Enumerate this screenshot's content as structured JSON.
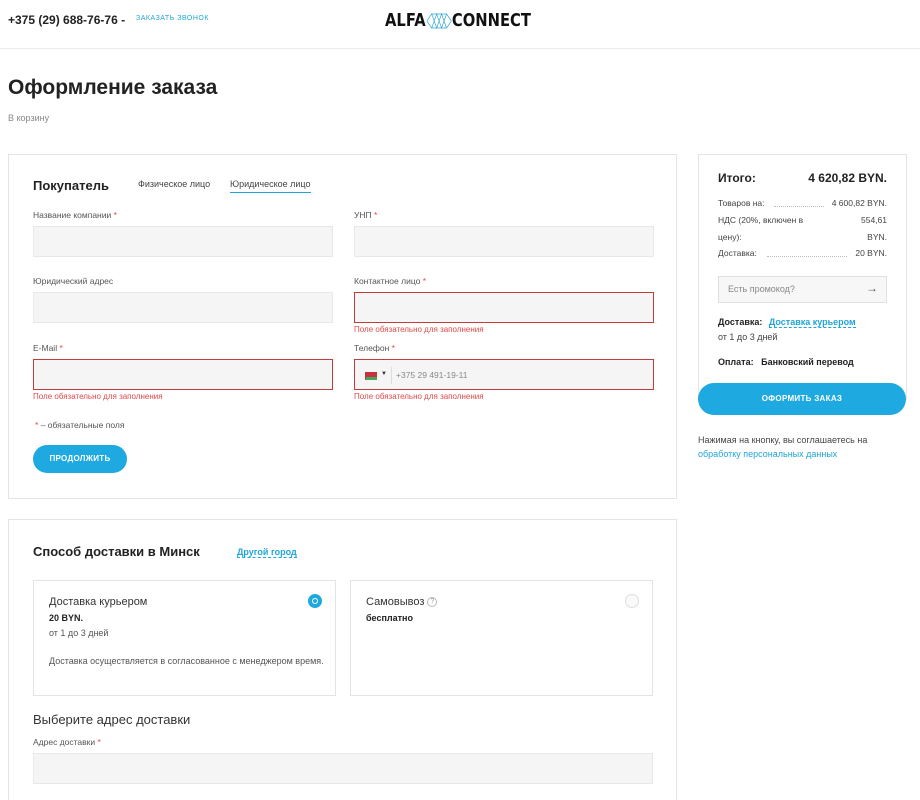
{
  "header": {
    "phone": "+375 (29) 688-76-76 -",
    "callback": "ЗАКАЗАТЬ ЗВОНОК",
    "logo_left": "ALFA",
    "logo_right": "CONNECT"
  },
  "page": {
    "title": "Оформление заказа",
    "back": "В корзину"
  },
  "buyer": {
    "title": "Покупатель",
    "tabs": [
      "Физическое лицо",
      "Юридическое лицо"
    ],
    "active_tab": "Юридическое лицо",
    "fields": {
      "company": {
        "label": "Название компании",
        "required": "*",
        "value": ""
      },
      "unp": {
        "label": "УНП",
        "required": "*",
        "value": ""
      },
      "address": {
        "label": "Юридический адрес",
        "value": ""
      },
      "contact": {
        "label": "Контактное лицо",
        "required": "*",
        "value": "",
        "error": "Поле обязательно для заполнения"
      },
      "email": {
        "label": "E-Mail",
        "required": "*",
        "value": "",
        "error": "Поле обязательно для заполнения"
      },
      "phone": {
        "label": "Телефон",
        "required": "*",
        "placeholder": "+375 29 491-19-11",
        "value": "",
        "error": "Поле обязательно для заполнения"
      }
    },
    "required_note_star": "*",
    "required_note": "– обязательные поля",
    "continue": "ПРОДОЛЖИТЬ"
  },
  "delivery": {
    "title": "Способ доставки в Минск",
    "other_city": "Другой город",
    "options": [
      {
        "name": "Доставка курьером",
        "price": "20 BYN.",
        "term": "от 1 до 3 дней",
        "desc": "Доставка осуществляется в согласованное с менеджером время.",
        "selected": true
      },
      {
        "name": "Самовывоз",
        "price": "бесплатно",
        "selected": false
      }
    ],
    "address_heading": "Выберите адрес доставки",
    "address_label": "Адрес доставки",
    "address_required": "*",
    "address_value": ""
  },
  "summary": {
    "total_label": "Итого:",
    "total_value": "4 620,82 BYN.",
    "rows": [
      {
        "label": "Товаров на:",
        "value": "4 600,82 BYN."
      },
      {
        "label": "НДС (20%, включен в",
        "value": "554,61"
      },
      {
        "label": "цену):",
        "value": "BYN."
      },
      {
        "label": "Доставка:",
        "value": "20 BYN."
      }
    ],
    "promo_placeholder": "Есть промокод?",
    "delivery_label": "Доставка:",
    "delivery_value": "Доставка курьером",
    "delivery_term": "от 1 до 3 дней",
    "payment_label": "Оплата:",
    "payment_value": "Банковский перевод",
    "order_button": "ОФОРМИТЬ ЗАКАЗ",
    "consent_text": "Нажимая на кнопку, вы соглашаетесь на",
    "consent_link": "обработку персональных данных"
  },
  "colors": {
    "accent": "#1fa9e1",
    "error": "#e04848"
  }
}
